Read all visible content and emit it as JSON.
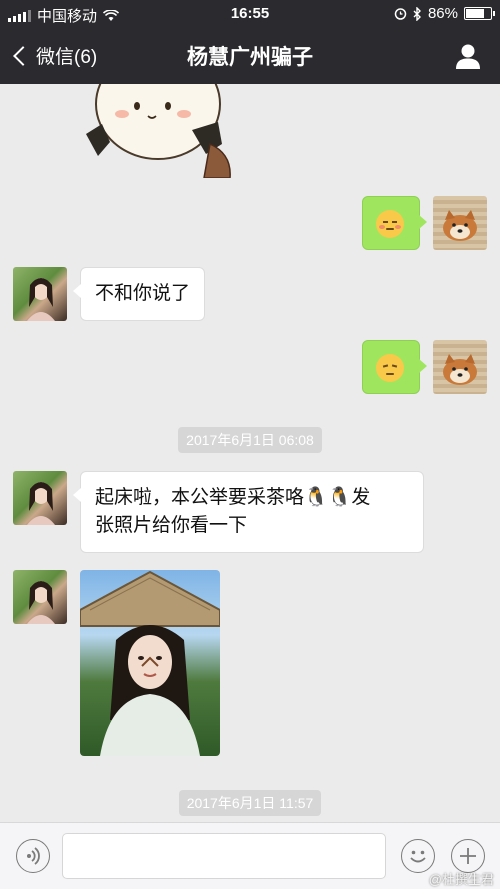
{
  "status_bar": {
    "carrier": "中国移动",
    "time": "16:55",
    "battery": "86%",
    "battery_level": 0.86
  },
  "nav": {
    "back_label": "微信(6)",
    "title": "杨慧广州骗子"
  },
  "messages": [
    {
      "type": "sticker",
      "from": "contact"
    },
    {
      "type": "emoji",
      "from": "me",
      "emoji": "flushed-face"
    },
    {
      "type": "text",
      "from": "contact",
      "text": "不和你说了"
    },
    {
      "type": "emoji",
      "from": "me",
      "emoji": "pensive-face"
    },
    {
      "type": "timestamp",
      "text": "2017年6月1日 06:08"
    },
    {
      "type": "text",
      "from": "contact",
      "line1": "起床啦，本公举要采茶咯🐧🐧发",
      "line2": "张照片给你看一下"
    },
    {
      "type": "photo",
      "from": "contact"
    },
    {
      "type": "timestamp",
      "text": "2017年6月1日 11:57"
    }
  ],
  "input_bar": {
    "value": ""
  },
  "watermark": "@杜撰生君",
  "colors": {
    "nav_bg": "#2b2b2f",
    "chat_bg": "#ebebeb",
    "green_bubble": "#9fe65e",
    "white_bubble": "#ffffff"
  }
}
